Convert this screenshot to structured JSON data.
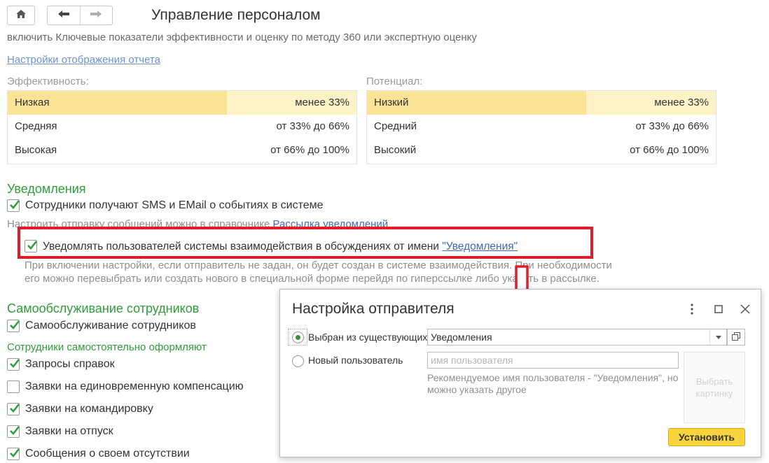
{
  "toolbar": {
    "home_icon": "home-icon",
    "back_icon": "arrow-left-icon",
    "forward_icon": "arrow-right-icon"
  },
  "page": {
    "title": "Управление персоналом",
    "description": "включить Ключевые показатели эффективности и оценку по методу 360 или экспертную оценку",
    "settings_link": "Настройки отображения отчета"
  },
  "efficiency": {
    "label": "Эффективность:",
    "rows": [
      {
        "name": "Низкая",
        "range": "менее 33%",
        "selected": true
      },
      {
        "name": "Средняя",
        "range": "от 33% до 66%",
        "selected": false
      },
      {
        "name": "Высокая",
        "range": "от 66% до 100%",
        "selected": false
      }
    ]
  },
  "potential": {
    "label": "Потенциал:",
    "rows": [
      {
        "name": "Низкий",
        "range": "менее 33%",
        "selected": true
      },
      {
        "name": "Средний",
        "range": "от 33% до 66%",
        "selected": false
      },
      {
        "name": "Высокий",
        "range": "от 66% до 100%",
        "selected": false
      }
    ]
  },
  "notifications": {
    "title": "Уведомления",
    "sms_email_label": "Сотрудники получают SMS и EMail о событиях в системе",
    "sms_email_checked": true,
    "mailing_prefix": "Настроить отправку сообщений можно в справочнике ",
    "mailing_link": "Рассылка уведомлений",
    "notify_label": "Уведомлять пользователей системы взаимодействия в обсуждениях от имени ",
    "notify_link": "\"Уведомления\"",
    "notify_checked": true,
    "hint_line1": "При включении настройки, если отправитель не задан, он будет создан в системе взаимодействия. При необходимости",
    "hint_line2": "его можно перевыбрать или создать нового в специальной форме перейдя по гиперссылке либо указать в рассылке."
  },
  "self_service": {
    "title": "Самообслуживание сотрудников",
    "main_label": "Самообслуживание сотрудников",
    "main_checked": true,
    "subtitle": "Сотрудники самостоятельно оформляют",
    "items": [
      {
        "label": "Запросы справок",
        "checked": true
      },
      {
        "label": "Заявки на единовременную компенсацию",
        "checked": false
      },
      {
        "label": "Заявки на командировку",
        "checked": true
      },
      {
        "label": "Заявки на отпуск",
        "checked": true
      },
      {
        "label": "Сообщения о своем отсутствии",
        "checked": true
      }
    ]
  },
  "dialog": {
    "title": "Настройка отправителя",
    "more_icon": "more-vertical-icon",
    "maximize_icon": "maximize-icon",
    "close_icon": "close-icon",
    "option_existing": "Выбран из существующих",
    "existing_value": "Уведомления",
    "option_new": "Новый пользователь",
    "username_placeholder": "имя пользователя",
    "recommend_note": "Рекомендуемое имя пользователя - \"Уведомления\", но можно указать другое",
    "choose_picture": "Выбрать картинку",
    "set_button": "Установить",
    "selected_option": "existing"
  },
  "colors": {
    "accent_green": "#2f9e3a",
    "highlight_red": "#e11d2a",
    "selected_row": "#fbe396",
    "primary_button": "#f7d43b",
    "link": "#3e6ab5"
  }
}
